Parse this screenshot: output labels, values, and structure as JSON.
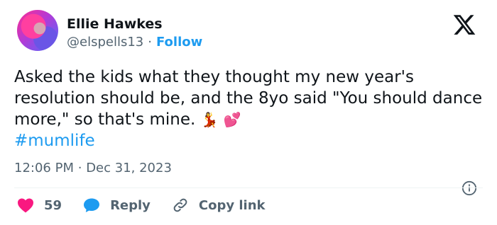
{
  "author": {
    "name": "Ellie Hawkes",
    "handle": "@elspells13",
    "separator": "·",
    "follow_label": "Follow"
  },
  "tweet": {
    "text": "Asked the kids what they thought my new year's resolution should be, and the 8yo said \"You should dance more,\" so that's mine.",
    "emojis": [
      "💃",
      "💕"
    ],
    "hashtag": "#mumlife"
  },
  "meta": {
    "time": "12:06 PM",
    "separator": "·",
    "date": "Dec 31, 2023"
  },
  "actions": {
    "like_count": "59",
    "reply_label": "Reply",
    "copy_link_label": "Copy link"
  },
  "colors": {
    "accent": "#1d9bf0",
    "like": "#f91880",
    "muted": "#536471"
  }
}
